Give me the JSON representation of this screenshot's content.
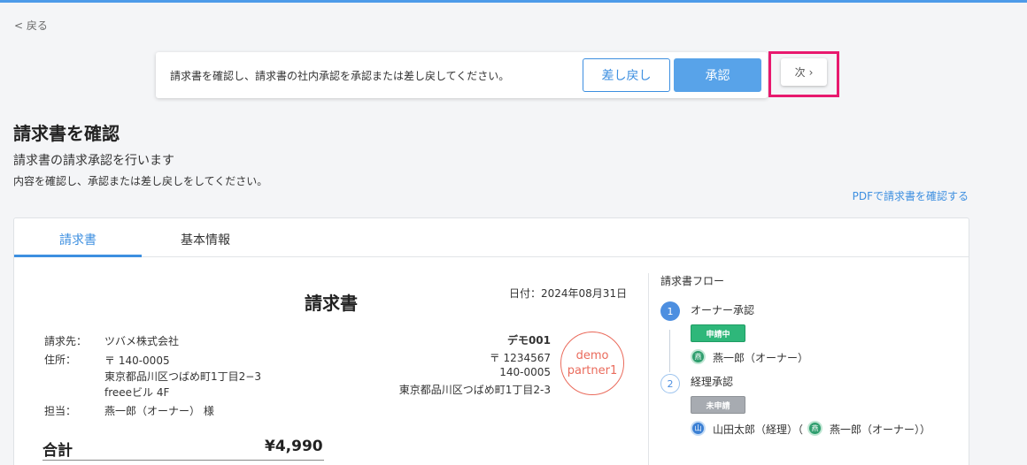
{
  "nav": {
    "back_label": "< 戻る"
  },
  "actionbar": {
    "message": "請求書を確認し、請求書の社内承認を承認または差し戻してください。",
    "return_label": "差し戻し",
    "approve_label": "承認",
    "next_label": "次",
    "next_chevron": "›"
  },
  "page": {
    "title": "請求書を確認",
    "subtitle": "請求書の請求承認を行います",
    "description": "内容を確認し、承認または差し戻しをしてください。",
    "pdf_link": "PDFで請求書を確認する"
  },
  "tabs": [
    {
      "label": "請求書"
    },
    {
      "label": "基本情報"
    }
  ],
  "invoice": {
    "title": "請求書",
    "date": "日付：2024年08月31日",
    "billing_to_label": "請求先：",
    "billing_to_value": "ツバメ株式会社",
    "address_label": "住所：",
    "address_lines": [
      "〒 140-0005",
      "東京都品川区つばめ町1丁目2−3",
      "freeeビル 4F"
    ],
    "contact_label": "担当：",
    "contact_value": "燕一郎（オーナー） 様",
    "issuer_lines": [
      "デモ001",
      "〒 1234567",
      "140-0005",
      "東京都品川区つばめ町1丁目2-3"
    ],
    "stamp_lines": [
      "demo",
      "partner1"
    ],
    "total_label": "合計",
    "total_value": "¥4,990"
  },
  "flow": {
    "title": "請求書フロー",
    "steps": [
      {
        "number": "1",
        "name": "オーナー承認",
        "status": "申請中",
        "approver_initial": "燕",
        "approver": "燕一郎（オーナー）"
      },
      {
        "number": "2",
        "name": "経理承認",
        "status": "未申請",
        "approver1_initial": "山",
        "approver1": "山田太郎（経理）（",
        "approver2_initial": "燕",
        "approver2": "燕一郎（オーナー））"
      }
    ]
  },
  "colors": {
    "accent": "#3d8fe0",
    "highlight": "#e8196e",
    "status_active": "#2eb77a",
    "status_inactive": "#a7abb1",
    "stamp": "#ea6b5c"
  }
}
